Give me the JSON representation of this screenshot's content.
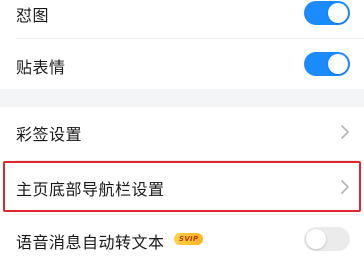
{
  "settings": {
    "items": [
      {
        "label": "怼图",
        "control": "toggle",
        "state": "on"
      },
      {
        "label": "贴表情",
        "control": "toggle",
        "state": "on"
      },
      {
        "label": "彩签设置",
        "control": "chevron"
      },
      {
        "label": "主页底部导航栏设置",
        "control": "chevron"
      },
      {
        "label": "语音消息自动转文本",
        "badge": "SVIP",
        "control": "toggle",
        "state": "off"
      }
    ]
  },
  "colors": {
    "accent": "#1a8cff",
    "highlight_border": "#e0262e",
    "section_gap": "#f4f5f7"
  }
}
